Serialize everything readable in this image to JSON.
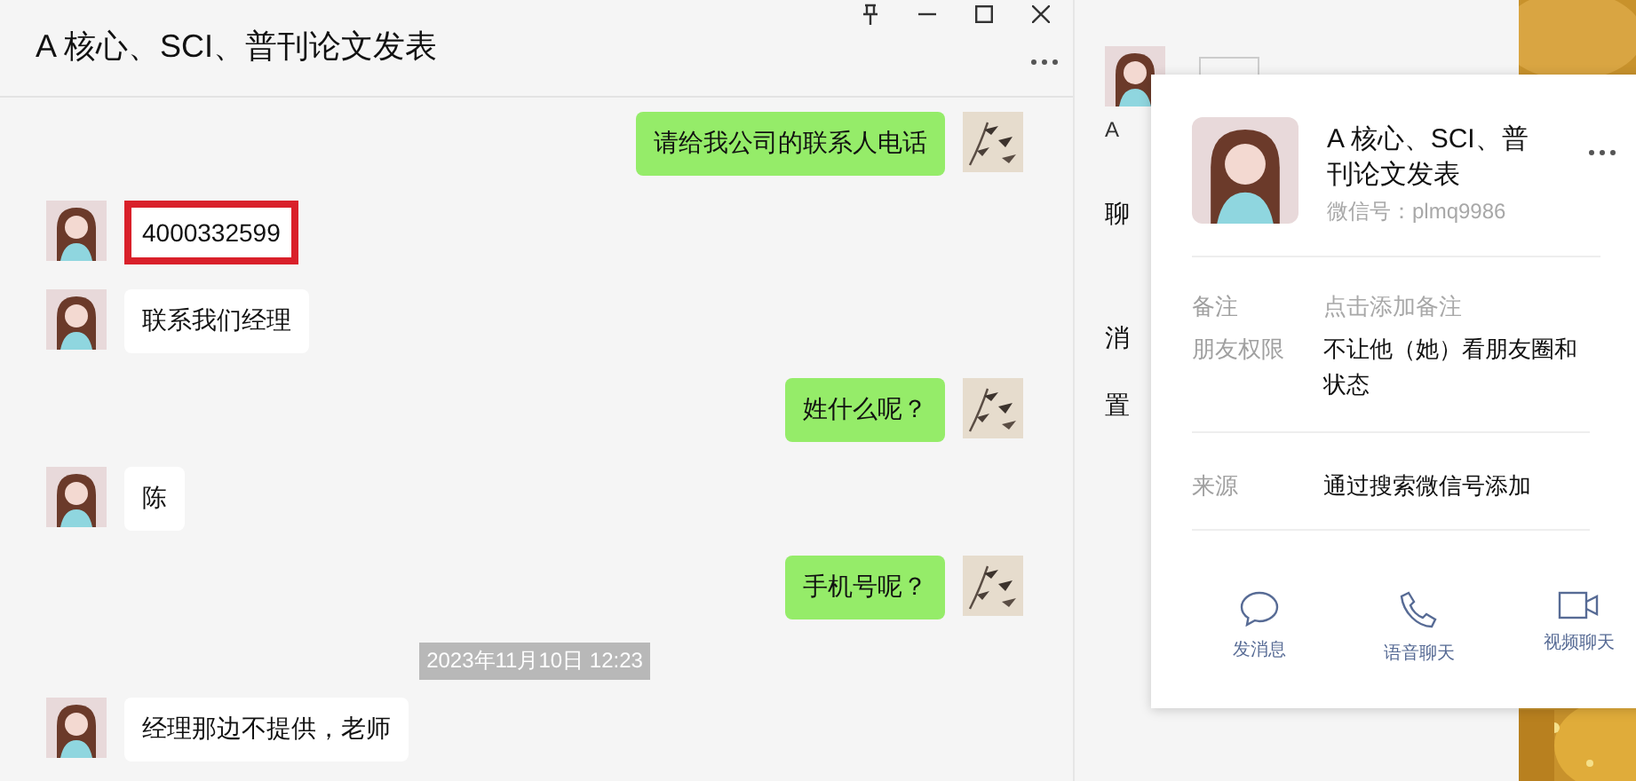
{
  "chat": {
    "title": "A 核心、SCI、普刊论文发表",
    "window_controls": [
      {
        "kind": "pin"
      },
      {
        "kind": "minimize"
      },
      {
        "kind": "maximize"
      },
      {
        "kind": "close"
      }
    ],
    "messages": [
      {
        "kind": "outgoing",
        "text": "请给我公司的联系人电话",
        "highlighted": false
      },
      {
        "kind": "incoming",
        "text": "4000332599",
        "highlighted": true
      },
      {
        "kind": "incoming",
        "text": "联系我们经理",
        "highlighted": false
      },
      {
        "kind": "outgoing",
        "text": "姓什么呢？",
        "highlighted": false
      },
      {
        "kind": "incoming",
        "text": "陈",
        "highlighted": false
      },
      {
        "kind": "outgoing",
        "text": "手机号呢？",
        "highlighted": false
      },
      {
        "kind": "time",
        "text": "2023年11月10日 12:23"
      },
      {
        "kind": "incoming",
        "text": "经理那边不提供，老师",
        "highlighted": false
      }
    ]
  },
  "side_panel": {
    "member_name": "A",
    "items": [
      "聊",
      "消",
      "置"
    ]
  },
  "profile_card": {
    "name": "A 核心、SCI、普刊论文发表",
    "wechat_id": "微信号：plmq9986",
    "fields": [
      {
        "label": "备注",
        "value": "点击添加备注",
        "kind": "hint"
      },
      {
        "label": "朋友权限",
        "value": "不让他（她）看朋友圈和状态",
        "kind": "value"
      },
      {
        "label": "来源",
        "value": "通过搜索微信号添加",
        "kind": "value"
      }
    ],
    "actions": [
      {
        "kind": "message",
        "label": "发消息"
      },
      {
        "kind": "voice",
        "label": "语音聊天"
      },
      {
        "kind": "video",
        "label": "视频聊天"
      }
    ]
  }
}
